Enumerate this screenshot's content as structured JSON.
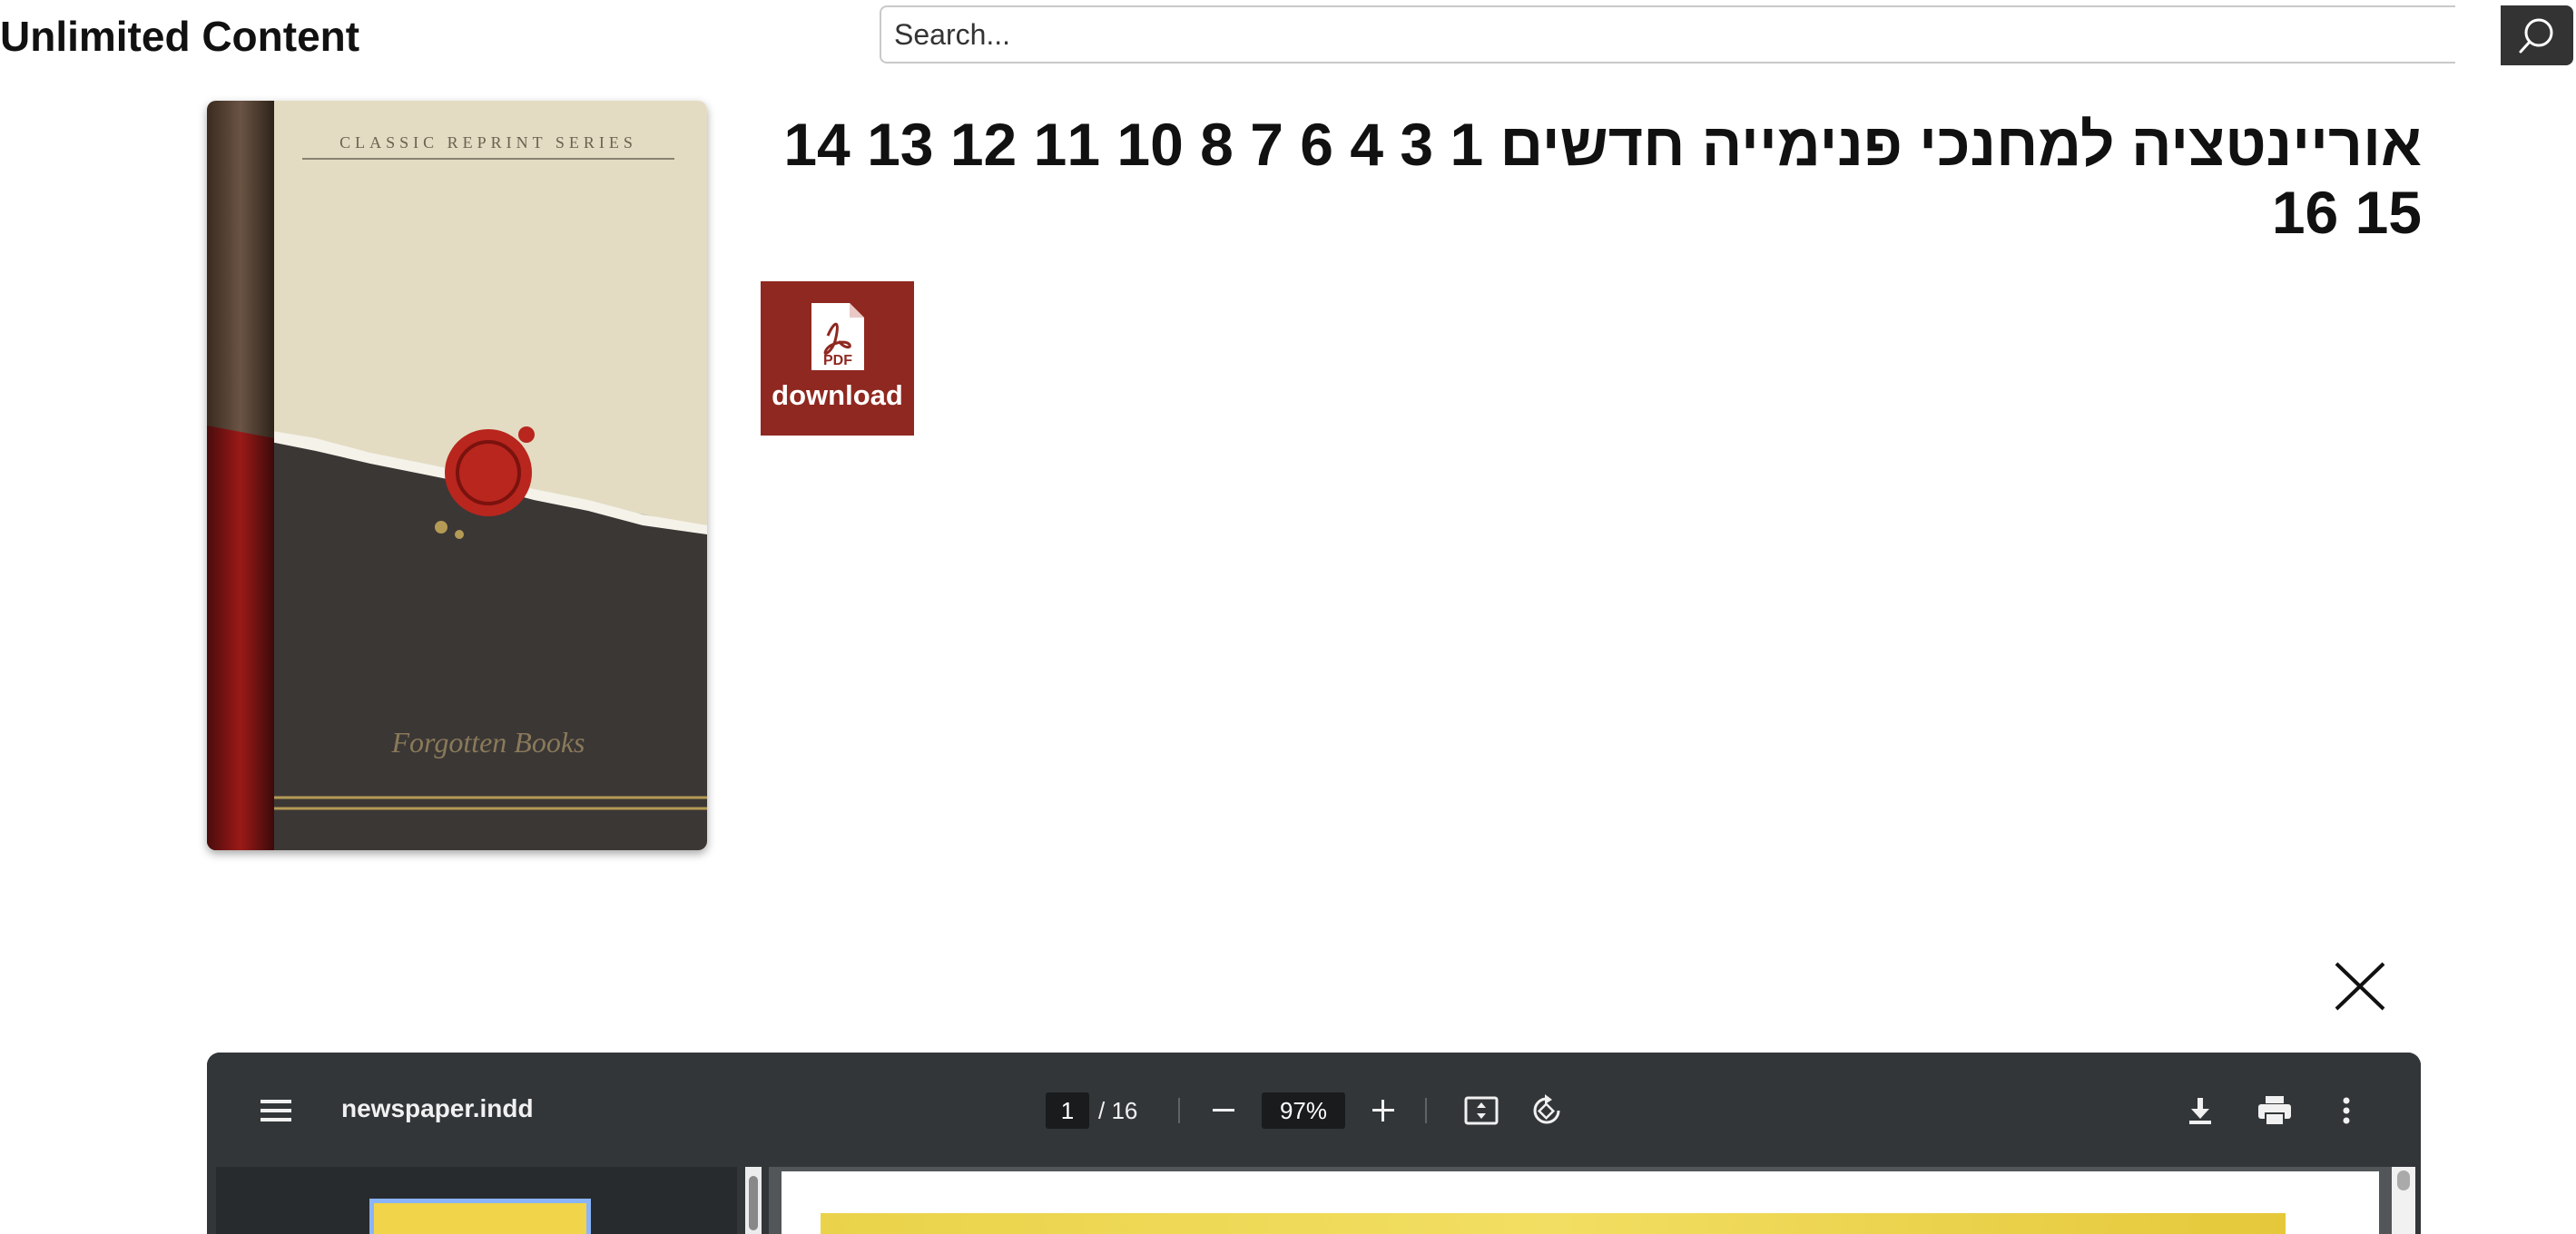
{
  "site": {
    "title": "Unlimited Content"
  },
  "search": {
    "placeholder": "Search..."
  },
  "book": {
    "title": "אוריינטציה למחנכי פנימייה חדשים 1 3 4 6 7 8 10 11 12 13 14 15 16",
    "cover": {
      "series_text": "CLASSIC REPRINT SERIES",
      "publisher_text": "Forgotten Books"
    }
  },
  "download": {
    "badge_text": "PDF",
    "label": "download"
  },
  "viewer": {
    "filename": "newspaper.indd",
    "current_page": "1",
    "page_total": "/ 16",
    "zoom": "97%"
  },
  "icons": [
    "search-icon",
    "pdf-icon",
    "close-icon",
    "menu-icon",
    "zoom-out-icon",
    "zoom-in-icon",
    "fit-page-icon",
    "rotate-icon",
    "download-icon",
    "print-icon",
    "more-icon"
  ],
  "colors": {
    "download_bg": "#8f2820",
    "viewer_toolbar": "#323639",
    "search_button": "#333333"
  }
}
